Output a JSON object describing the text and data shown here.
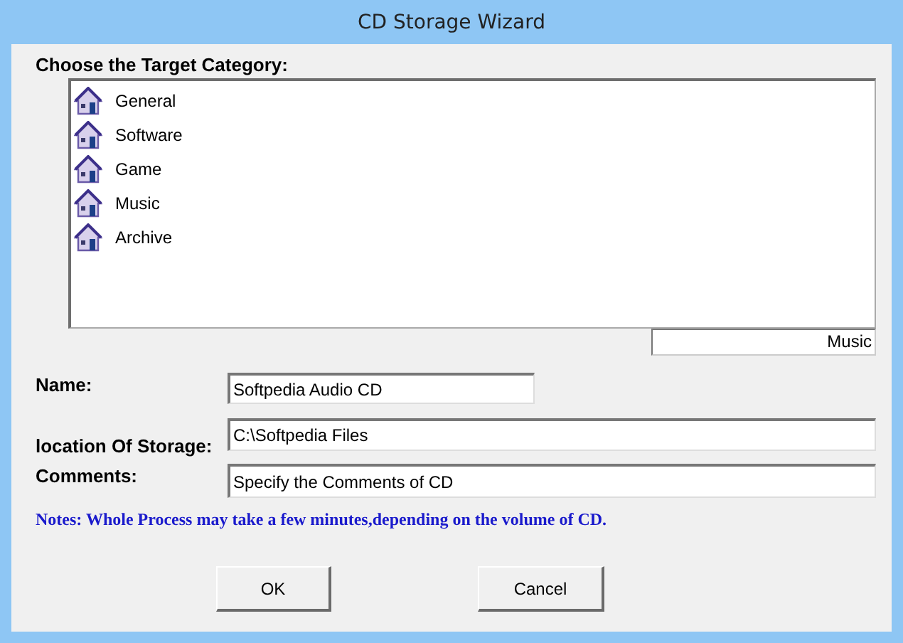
{
  "window": {
    "title": "CD Storage Wizard"
  },
  "category_label": "Choose the Target Category:",
  "categories": [
    {
      "label": "General"
    },
    {
      "label": "Software"
    },
    {
      "label": "Game"
    },
    {
      "label": "Music"
    },
    {
      "label": "Archive"
    }
  ],
  "selected_category": "Music",
  "fields": [
    {
      "label": "Name:",
      "value": "Softpedia Audio CD",
      "wide": false
    },
    {
      "label": "location Of Storage:",
      "value": "C:\\Softpedia Files",
      "wide": true
    },
    {
      "label": "Comments:",
      "value": "Specify the Comments of CD",
      "wide": true
    }
  ],
  "notes": "Notes: Whole Process may take a few minutes,depending on the volume of CD.",
  "buttons": [
    "OK",
    "Cancel"
  ]
}
